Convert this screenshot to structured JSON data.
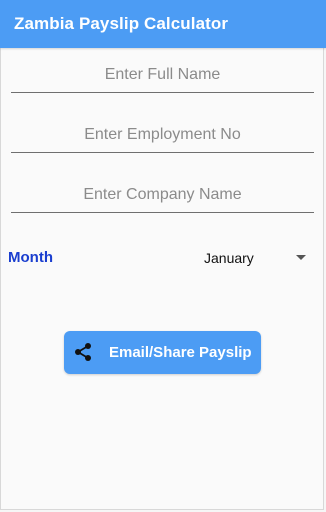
{
  "app_bar": {
    "title": "Zambia Payslip Calculator"
  },
  "form": {
    "full_name": {
      "placeholder": "Enter Full Name",
      "value": ""
    },
    "employment_no": {
      "placeholder": "Enter Employment No",
      "value": ""
    },
    "company_name": {
      "placeholder": "Enter Company Name",
      "value": ""
    },
    "month": {
      "label": "Month",
      "selected": "January"
    }
  },
  "actions": {
    "share_label": "Email/Share Payslip",
    "share_icon": "share-icon"
  },
  "colors": {
    "primary": "#4c9cf4",
    "month_label": "#1a3ecf"
  }
}
